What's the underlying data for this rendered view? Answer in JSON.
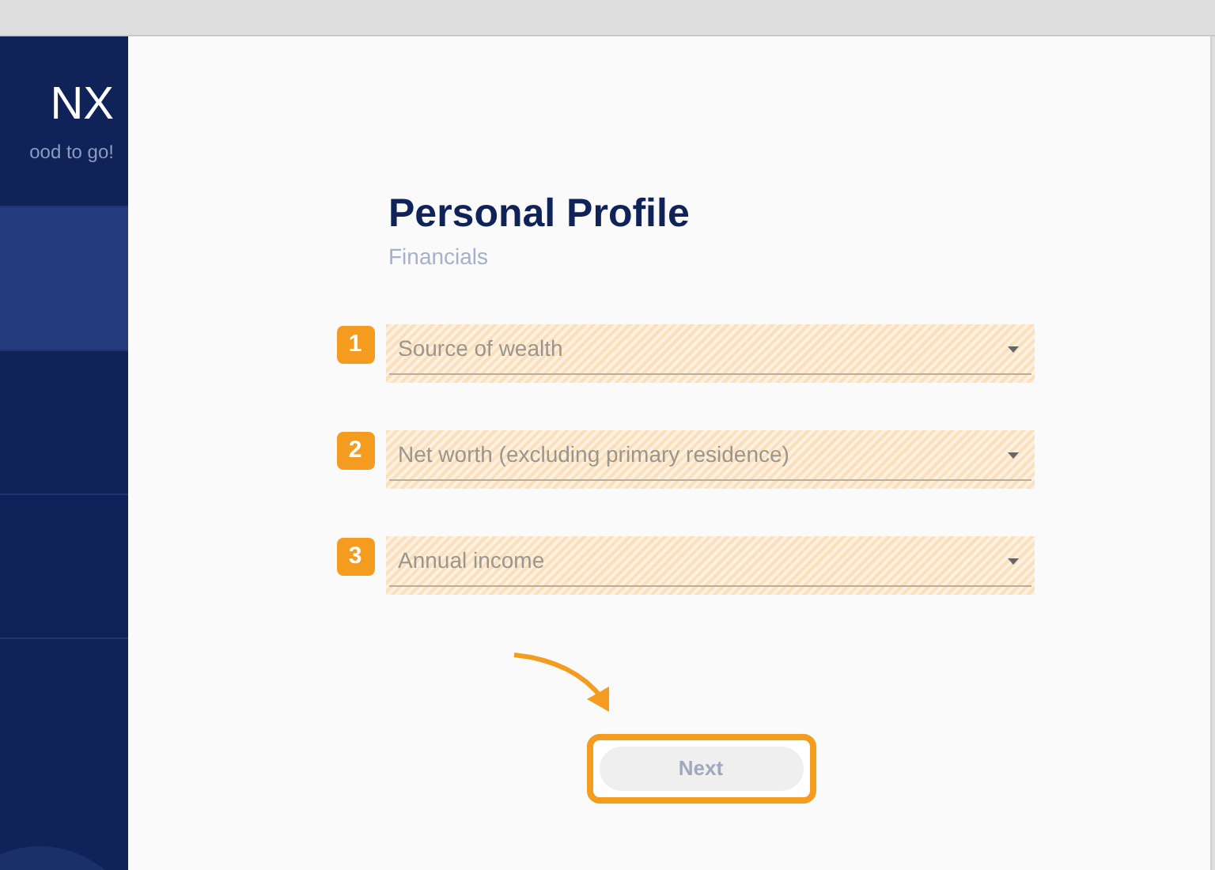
{
  "sidebar": {
    "logo": "NX",
    "tagline": "ood to go!",
    "items": [
      {
        "selected": true
      },
      {
        "selected": false
      },
      {
        "selected": false
      }
    ]
  },
  "page": {
    "title": "Personal Profile",
    "subtitle": "Financials"
  },
  "fields": [
    {
      "number": "1",
      "placeholder": "Source of wealth"
    },
    {
      "number": "2",
      "placeholder": "Net worth (excluding primary residence)"
    },
    {
      "number": "3",
      "placeholder": "Annual income"
    }
  ],
  "next_button": {
    "label": "Next",
    "disabled": true,
    "highlighted": true
  }
}
